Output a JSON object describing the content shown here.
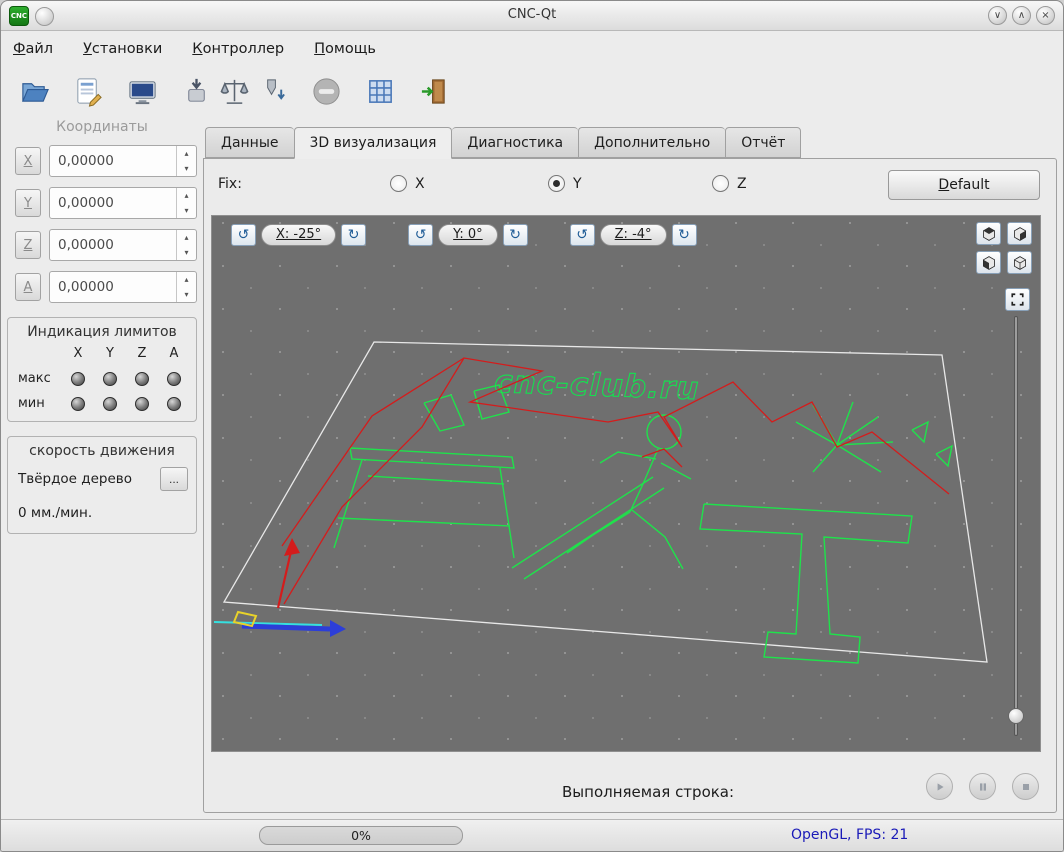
{
  "window": {
    "title": "CNC-Qt",
    "badge": "CNC"
  },
  "icons": {
    "rotate_left": "↺",
    "rotate_right": "↻",
    "spin_up": "▴",
    "spin_down": "▾",
    "shade": "∨",
    "unshade": "∧",
    "close": "×"
  },
  "menu": {
    "items": [
      {
        "label": "Файл"
      },
      {
        "label": "Установки"
      },
      {
        "label": "Контроллер"
      },
      {
        "label": "Помощь"
      }
    ]
  },
  "sidebar": {
    "coordinates": {
      "title": "Координаты",
      "axes": [
        {
          "label": "X",
          "value": "0,00000"
        },
        {
          "label": "Y",
          "value": "0,00000"
        },
        {
          "label": "Z",
          "value": "0,00000"
        },
        {
          "label": "A",
          "value": "0,00000"
        }
      ]
    },
    "limits": {
      "title": "Индикация лимитов",
      "columns": [
        "X",
        "Y",
        "Z",
        "A"
      ],
      "rows": [
        "макс",
        "мин"
      ]
    },
    "speed": {
      "title": "скорость движения",
      "material": "Твёрдое дерево",
      "more": "...",
      "rate": "0 мм./мин."
    }
  },
  "tabs": [
    {
      "label": "Данные"
    },
    {
      "label": "3D визуализация"
    },
    {
      "label": "Диагностика"
    },
    {
      "label": "Дополнительно"
    },
    {
      "label": "Отчёт"
    }
  ],
  "fix": {
    "label": "Fix:",
    "options": [
      {
        "label": "X"
      },
      {
        "label": "Y"
      },
      {
        "label": "Z"
      }
    ],
    "selected": "Y",
    "default_label": "Default"
  },
  "viewport": {
    "rotation": [
      {
        "value": "X: -25°"
      },
      {
        "value": "Y: 0°"
      },
      {
        "value": "Z: -4°"
      }
    ],
    "watermark": "cnc-club.ru"
  },
  "bottom": {
    "label": "Выполняемая строка:"
  },
  "status": {
    "progress": "0%",
    "fps": "OpenGL, FPS: 21"
  }
}
